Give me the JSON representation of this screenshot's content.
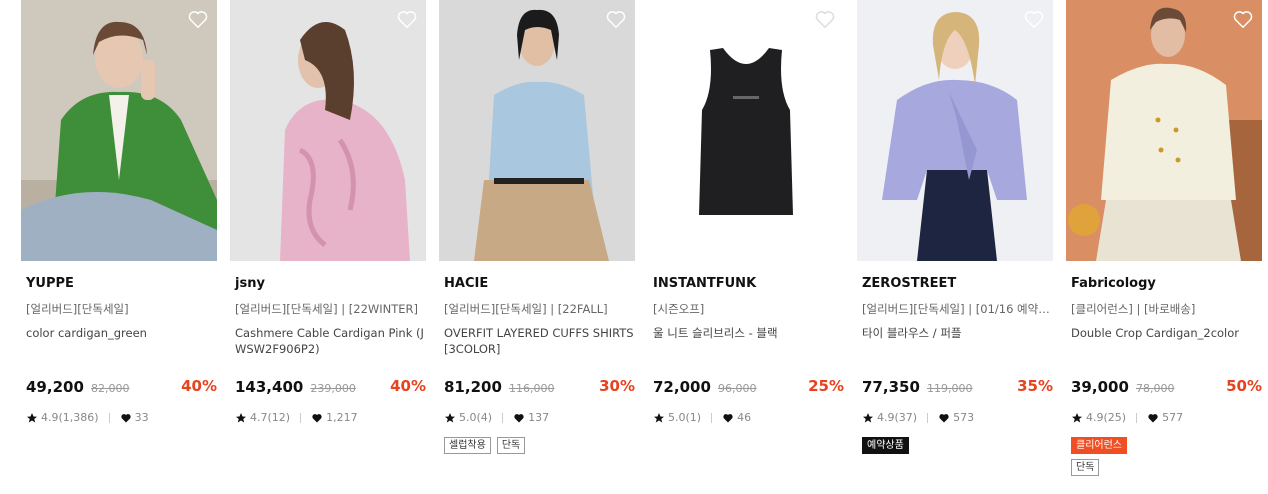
{
  "products": [
    {
      "brand": "YUPPE",
      "tags": "[얼리버드][단독세일]",
      "name": "color cardigan_green",
      "price": "49,200",
      "original_price": "82,000",
      "discount": "40%",
      "rating": "4.9(1,386)",
      "likes": "33",
      "badges": []
    },
    {
      "brand": "jsny",
      "tags": "[얼리버드][단독세일] | [22WINTER]",
      "name": "Cashmere Cable Cardigan Pink (JWSW2F906P2)",
      "price": "143,400",
      "original_price": "239,000",
      "discount": "40%",
      "rating": "4.7(12)",
      "likes": "1,217",
      "badges": []
    },
    {
      "brand": "HACIE",
      "tags": "[얼리버드][단독세일] | [22FALL]",
      "name": "OVERFIT LAYERED CUFFS SHIRTS [3COLOR]",
      "price": "81,200",
      "original_price": "116,000",
      "discount": "30%",
      "rating": "5.0(4)",
      "likes": "137",
      "badges": [
        {
          "text": "셀럽착용",
          "style": "outline"
        },
        {
          "text": "단독",
          "style": "outline"
        }
      ]
    },
    {
      "brand": "INSTANTFUNK",
      "tags": "[시즌오프]",
      "name": "울 니트 슬리브리스 - 블랙",
      "price": "72,000",
      "original_price": "96,000",
      "discount": "25%",
      "rating": "5.0(1)",
      "likes": "46",
      "badges": []
    },
    {
      "brand": "ZEROSTREET",
      "tags": "[얼리버드][단독세일] | [01/16 예약배...",
      "name": "타이 블라우스 / 퍼플",
      "price": "77,350",
      "original_price": "119,000",
      "discount": "35%",
      "rating": "4.9(37)",
      "likes": "573",
      "badges": [
        {
          "text": "예약상품",
          "style": "dark"
        }
      ]
    },
    {
      "brand": "Fabricology",
      "tags": "[클리어런스] | [바로배송]",
      "name": "Double Crop Cardigan_2color",
      "price": "39,000",
      "original_price": "78,000",
      "discount": "50%",
      "rating": "4.9(25)",
      "likes": "577",
      "badges": [
        {
          "text": "클리어런스",
          "style": "orange"
        },
        {
          "text": "단독",
          "style": "outline"
        }
      ]
    }
  ],
  "colors": {
    "discount": "#e8431f",
    "clearance_badge": "#f04e23",
    "reserve_badge": "#111111"
  },
  "icons": {
    "wishlist": "heart-outline-icon",
    "rating": "star-icon",
    "likes": "heart-filled-icon"
  }
}
